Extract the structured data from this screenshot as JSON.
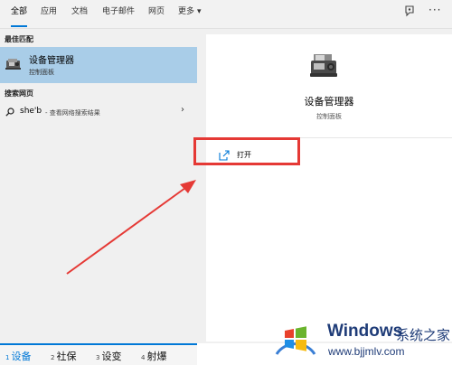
{
  "tabs": [
    {
      "label": "全部",
      "active": true
    },
    {
      "label": "应用"
    },
    {
      "label": "文档"
    },
    {
      "label": "电子邮件"
    },
    {
      "label": "网页"
    },
    {
      "label": "更多"
    }
  ],
  "left": {
    "best_match_label": "最佳匹配",
    "best_item": {
      "title": "设备管理器",
      "subtitle": "控制面板"
    },
    "web_label": "搜索网页",
    "web_item": {
      "query": "she'b",
      "suffix": " - 查看网络搜索结果"
    }
  },
  "right": {
    "title": "设备管理器",
    "subtitle": "控制面板",
    "action_open": "打开"
  },
  "ime_candidates": [
    {
      "num": "1",
      "text": "设备"
    },
    {
      "num": "2",
      "text": "社保"
    },
    {
      "num": "3",
      "text": "设变"
    },
    {
      "num": "4",
      "text": "射爆"
    }
  ],
  "watermark": {
    "brand": "Windows",
    "sub": "系统之家",
    "url": "www.bjjmlv.com"
  },
  "colors": {
    "accent": "#0078d7",
    "selection": "#a9cde8",
    "highlight_red": "#e53935"
  }
}
